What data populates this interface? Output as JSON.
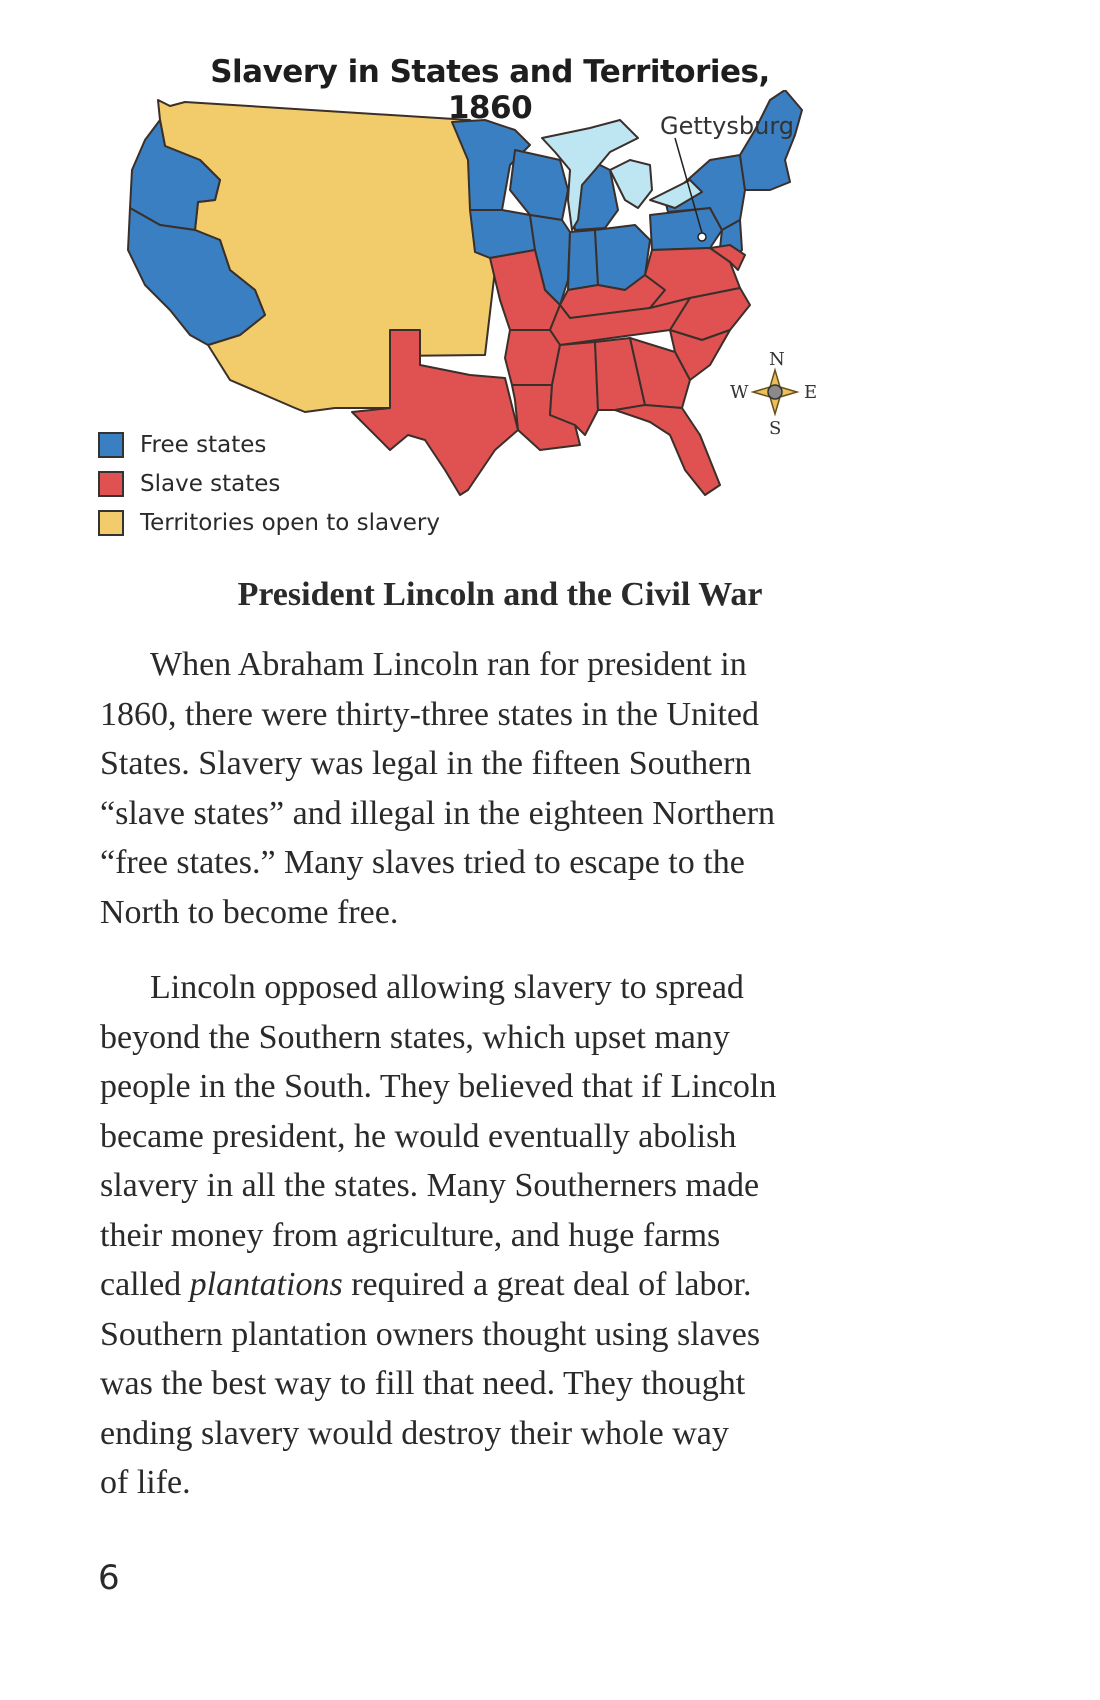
{
  "map": {
    "title": "Slavery in States and Territories, 1860",
    "annotation": "Gettysburg",
    "compass": {
      "n": "N",
      "s": "S",
      "e": "E",
      "w": "W"
    },
    "colors": {
      "free": "#3a7fc1",
      "slave": "#e05252",
      "territory": "#f2cc6a",
      "lakes": "#bde6f2",
      "outline": "#3a2f2a"
    },
    "legend": [
      {
        "label": "Free states",
        "color": "#3a7fc1"
      },
      {
        "label": "Slave states",
        "color": "#e05252"
      },
      {
        "label": "Territories open to slavery",
        "color": "#f2cc6a"
      }
    ]
  },
  "heading": "President Lincoln and the Civil War",
  "paragraph1": {
    "lines": [
      "When Abraham Lincoln ran for president in",
      "1860, there were thirty-three states in the United",
      "States. Slavery was legal in the fifteen Southern",
      "“slave states” and illegal in the eighteen Northern",
      "“free states.” Many slaves tried to escape to the",
      "North to become free."
    ]
  },
  "paragraph2": {
    "lines": [
      "Lincoln opposed allowing slavery to spread",
      "beyond the Southern states, which upset many",
      "people in the South. They believed that if Lincoln",
      "became president, he would eventually abolish",
      "slavery in all the states. Many Southerners made",
      "their money from agriculture, and huge farms"
    ],
    "plantations_line": {
      "before": "called ",
      "italic": "plantations",
      "after": " required a great deal of labor."
    },
    "lines_after": [
      "Southern plantation owners thought using slaves",
      "was the best way to fill that need. They thought",
      "ending slavery would destroy their whole way",
      "of life."
    ]
  },
  "page_number": "6"
}
